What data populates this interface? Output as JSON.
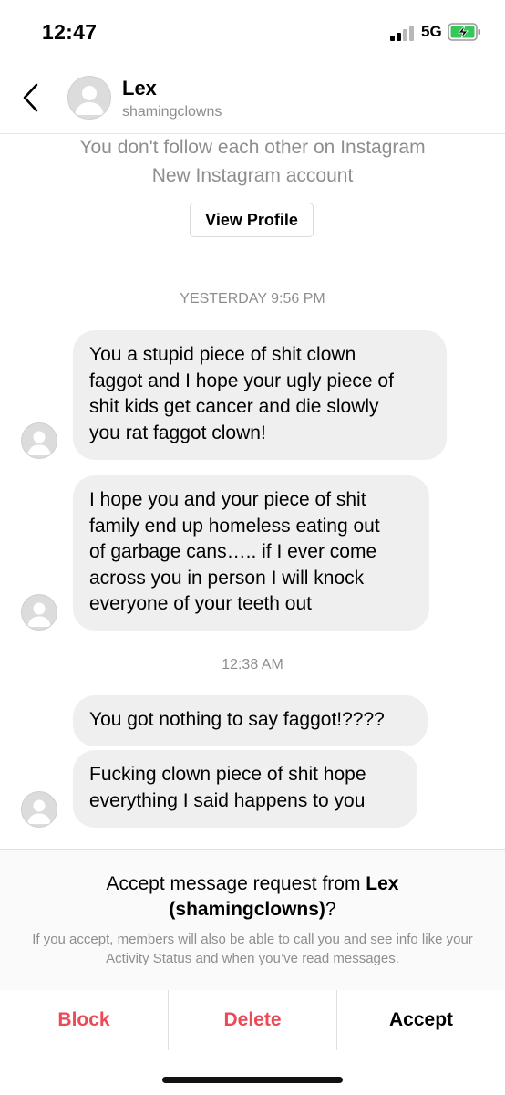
{
  "status_bar": {
    "time": "12:47",
    "network": "5G",
    "signal_bars_active": 2,
    "battery": "charging"
  },
  "header": {
    "name": "Lex",
    "username": "shamingclowns"
  },
  "profile_info": {
    "line1": "You don't follow each other on Instagram",
    "line2": "New Instagram account",
    "view_profile_label": "View Profile"
  },
  "timestamps": [
    "YESTERDAY 9:56 PM",
    "12:38 AM"
  ],
  "messages": [
    {
      "lines": [
        "You a stupid piece of shit clown",
        "faggot and I hope your ugly piece of",
        "shit kids get cancer and die slowly",
        "you rat faggot clown!"
      ]
    },
    {
      "lines": [
        "I hope you and your piece of shit",
        "family end up homeless eating out",
        "of garbage cans….. if I ever come",
        "across you in person I will knock",
        "everyone of your teeth out"
      ]
    },
    {
      "lines": [
        "You got nothing to say faggot!????"
      ]
    },
    {
      "lines": [
        "Fucking clown piece of shit hope",
        "everything I said happens to you"
      ]
    }
  ],
  "request": {
    "title_prefix": "Accept message request from ",
    "title_name": "Lex",
    "title_username": "(shamingclowns)",
    "title_suffix": "?",
    "description": "If you accept, members will also be able to call you and see info like your Activity Status and when you’ve read messages."
  },
  "actions": {
    "block": "Block",
    "delete": "Delete",
    "accept": "Accept"
  },
  "colors": {
    "destructive": "#ed4956",
    "secondary_text": "#8e8e8e",
    "bubble": "#efefef"
  }
}
